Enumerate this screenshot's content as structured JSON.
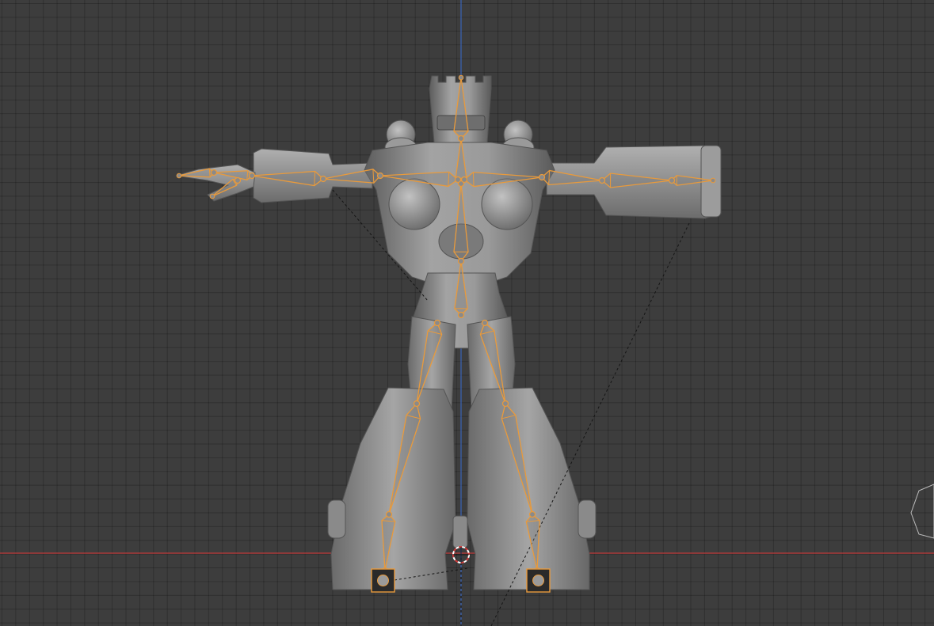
{
  "viewport": {
    "background": "#3d3d3d",
    "grid_line_color": "#2f2f2f",
    "x_axis_color": "#c43c3c",
    "z_axis_color": "#3a63b8"
  },
  "model": {
    "mesh_color": "#8f8f8f",
    "mesh_shadow": "#5c5c5c",
    "mesh_highlight": "#b8b8b8"
  },
  "armature": {
    "bone_outline_color": "#e89a3c",
    "bone_fill_color": "#7a7a7a",
    "relationship_line_color": "#1a1a1a",
    "ik_target_fill": "#2a2a2a"
  },
  "cursor": {
    "name": "3d-cursor",
    "ring_color_a": "#cf3a3a",
    "ring_color_b": "#ffffff"
  }
}
